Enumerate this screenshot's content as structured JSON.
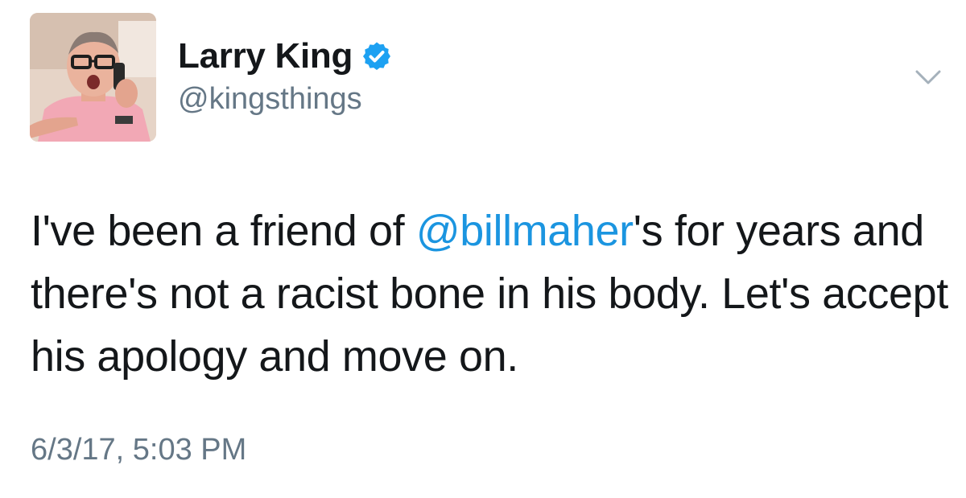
{
  "tweet": {
    "author": {
      "display_name": "Larry King",
      "handle": "@kingsthings",
      "verified_icon": "verified-badge-icon",
      "avatar_alt": "profile photo"
    },
    "menu_icon": "chevron-down-icon",
    "text": {
      "part1": "I've been a friend of ",
      "mention": "@billmaher",
      "part2": "'s for years and there's not a racist bone in his body. Let's accept his apology and move on."
    },
    "timestamp": "6/3/17, 5:03 PM"
  },
  "colors": {
    "link": "#1b95e0",
    "verified": "#1da1f2",
    "secondary_text": "#657786",
    "primary_text": "#14171a"
  }
}
